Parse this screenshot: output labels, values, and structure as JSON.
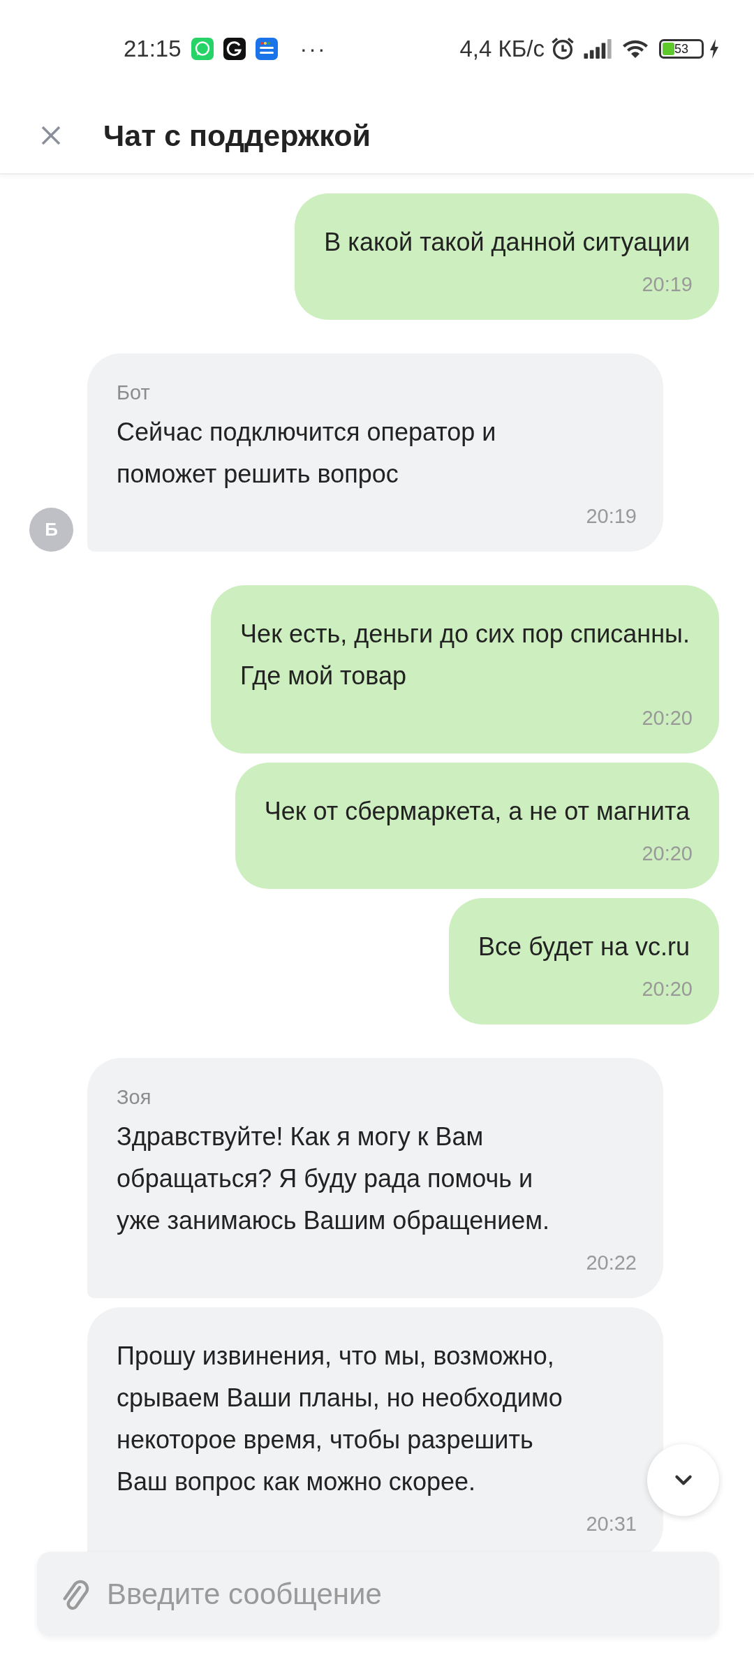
{
  "status_bar": {
    "time": "21:15",
    "more": "···",
    "network_speed": "4,4 КБ/с",
    "battery": "53"
  },
  "header": {
    "title": "Чат с поддержкой"
  },
  "messages": [
    {
      "kind": "outgoing",
      "text": "В какой такой данной ситуации",
      "time": "20:19"
    },
    {
      "kind": "incoming",
      "sender": "Бот",
      "avatar": "Б",
      "text": "Сейчас подключится оператор и\nпоможет решить вопрос",
      "time": "20:19"
    },
    {
      "kind": "outgoing",
      "text": "Чек есть, деньги до сих пор списанны.\nГде мой товар",
      "time": "20:20"
    },
    {
      "kind": "outgoing",
      "text": "Чек от сбермаркета, а не от магнита",
      "time": "20:20"
    },
    {
      "kind": "outgoing",
      "text": "Все будет на vc.ru",
      "time": "20:20"
    },
    {
      "kind": "incoming",
      "sender": "Зоя",
      "text": "Здравствуйте! Как я могу к Вам\nобращаться? Я буду рада помочь и\nуже занимаюсь Вашим обращением.",
      "time": "20:22"
    },
    {
      "kind": "incoming",
      "text": "Прошу извинения, что мы, возможно,\nсрываем Ваши планы, но необходимо\nнекоторое время, чтобы разрешить\nВаш вопрос как можно скорее.",
      "time": "20:31"
    }
  ],
  "composer": {
    "placeholder": "Введите сообщение"
  }
}
